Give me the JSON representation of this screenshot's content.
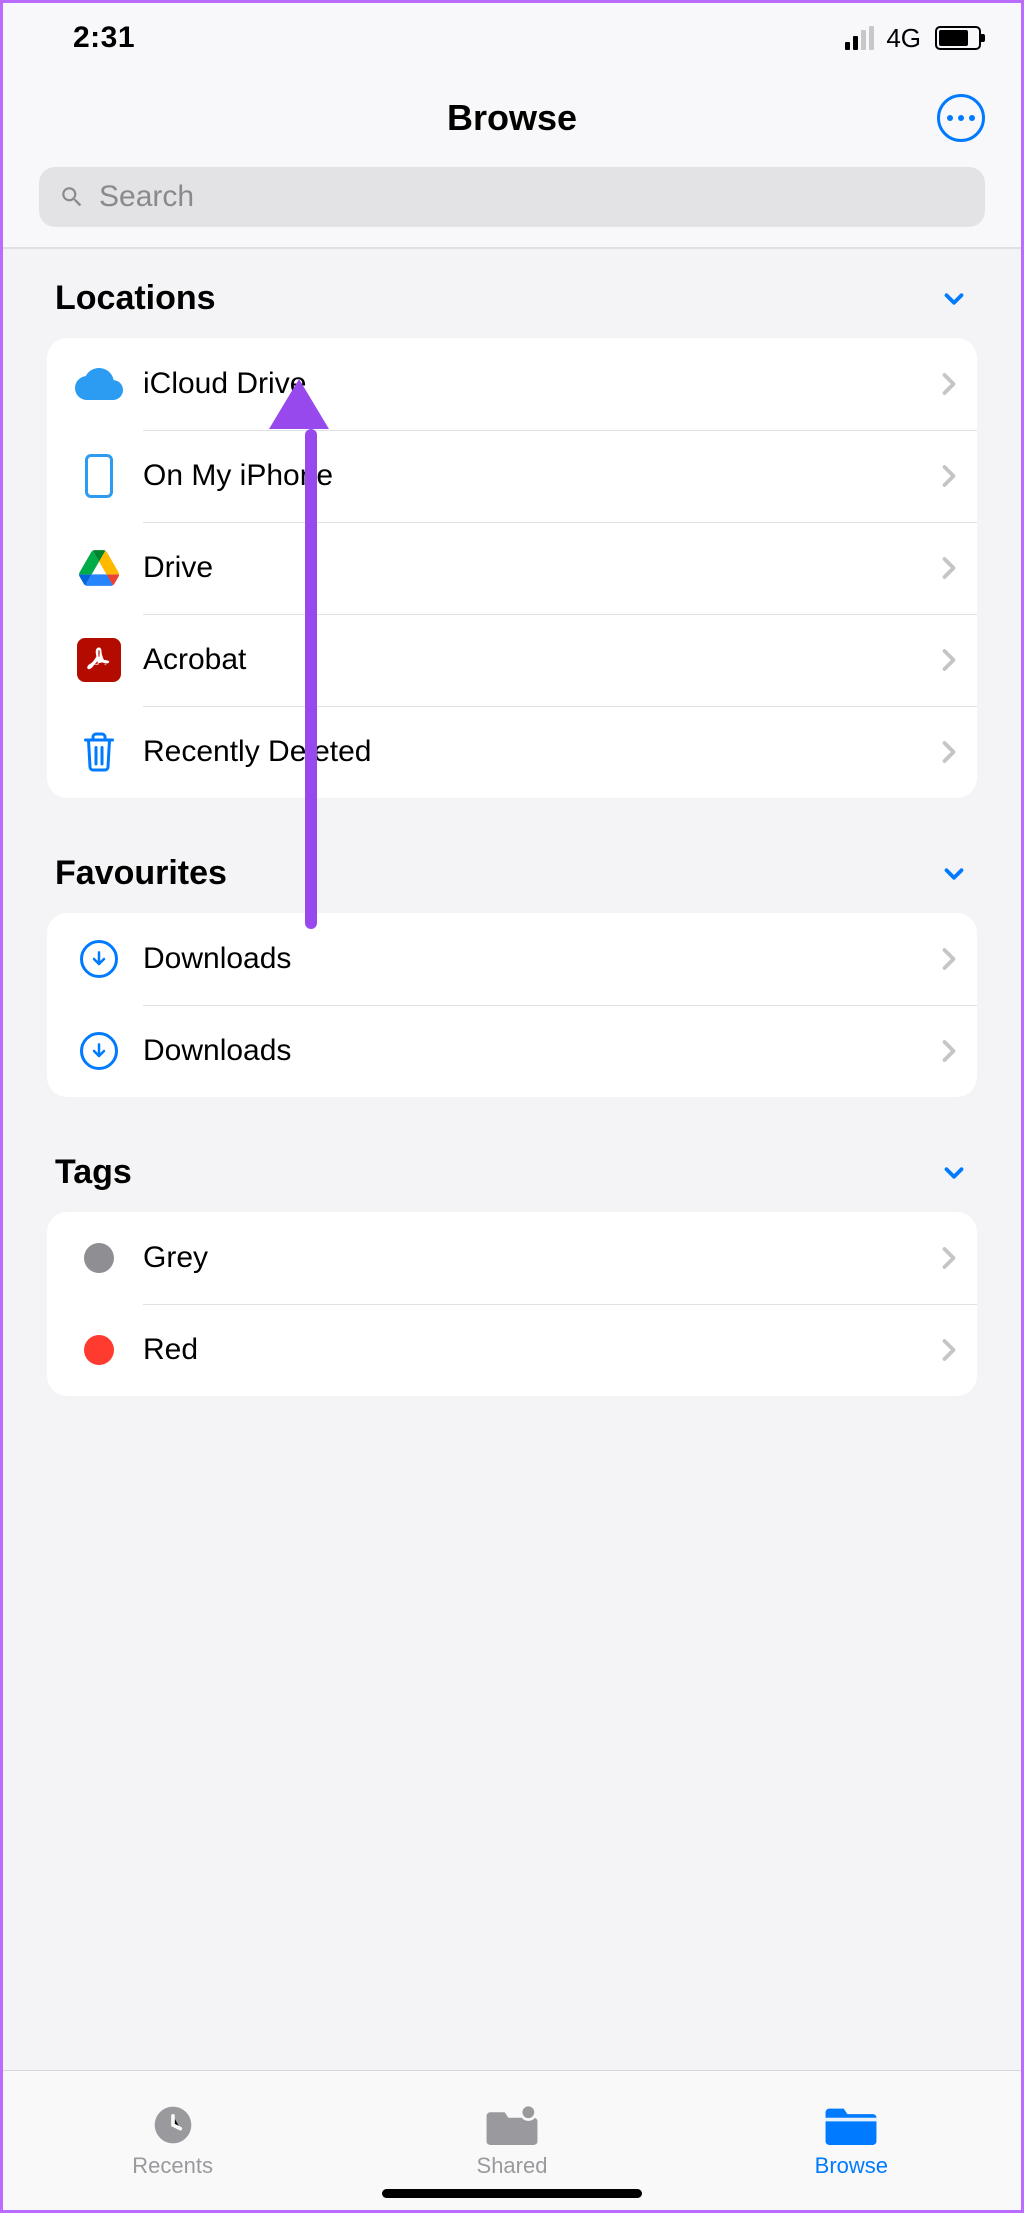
{
  "status": {
    "time": "2:31",
    "network": "4G"
  },
  "header": {
    "title": "Browse"
  },
  "search": {
    "placeholder": "Search"
  },
  "sections": {
    "locations": {
      "title": "Locations",
      "items": [
        {
          "label": "iCloud Drive"
        },
        {
          "label": "On My iPhone"
        },
        {
          "label": "Drive"
        },
        {
          "label": "Acrobat"
        },
        {
          "label": "Recently Deleted"
        }
      ]
    },
    "favourites": {
      "title": "Favourites",
      "items": [
        {
          "label": "Downloads"
        },
        {
          "label": "Downloads"
        }
      ]
    },
    "tags": {
      "title": "Tags",
      "items": [
        {
          "label": "Grey",
          "color": "#8e8e93"
        },
        {
          "label": "Red",
          "color": "#ff3b30"
        }
      ]
    }
  },
  "tabs": {
    "recents": "Recents",
    "shared": "Shared",
    "browse": "Browse"
  }
}
